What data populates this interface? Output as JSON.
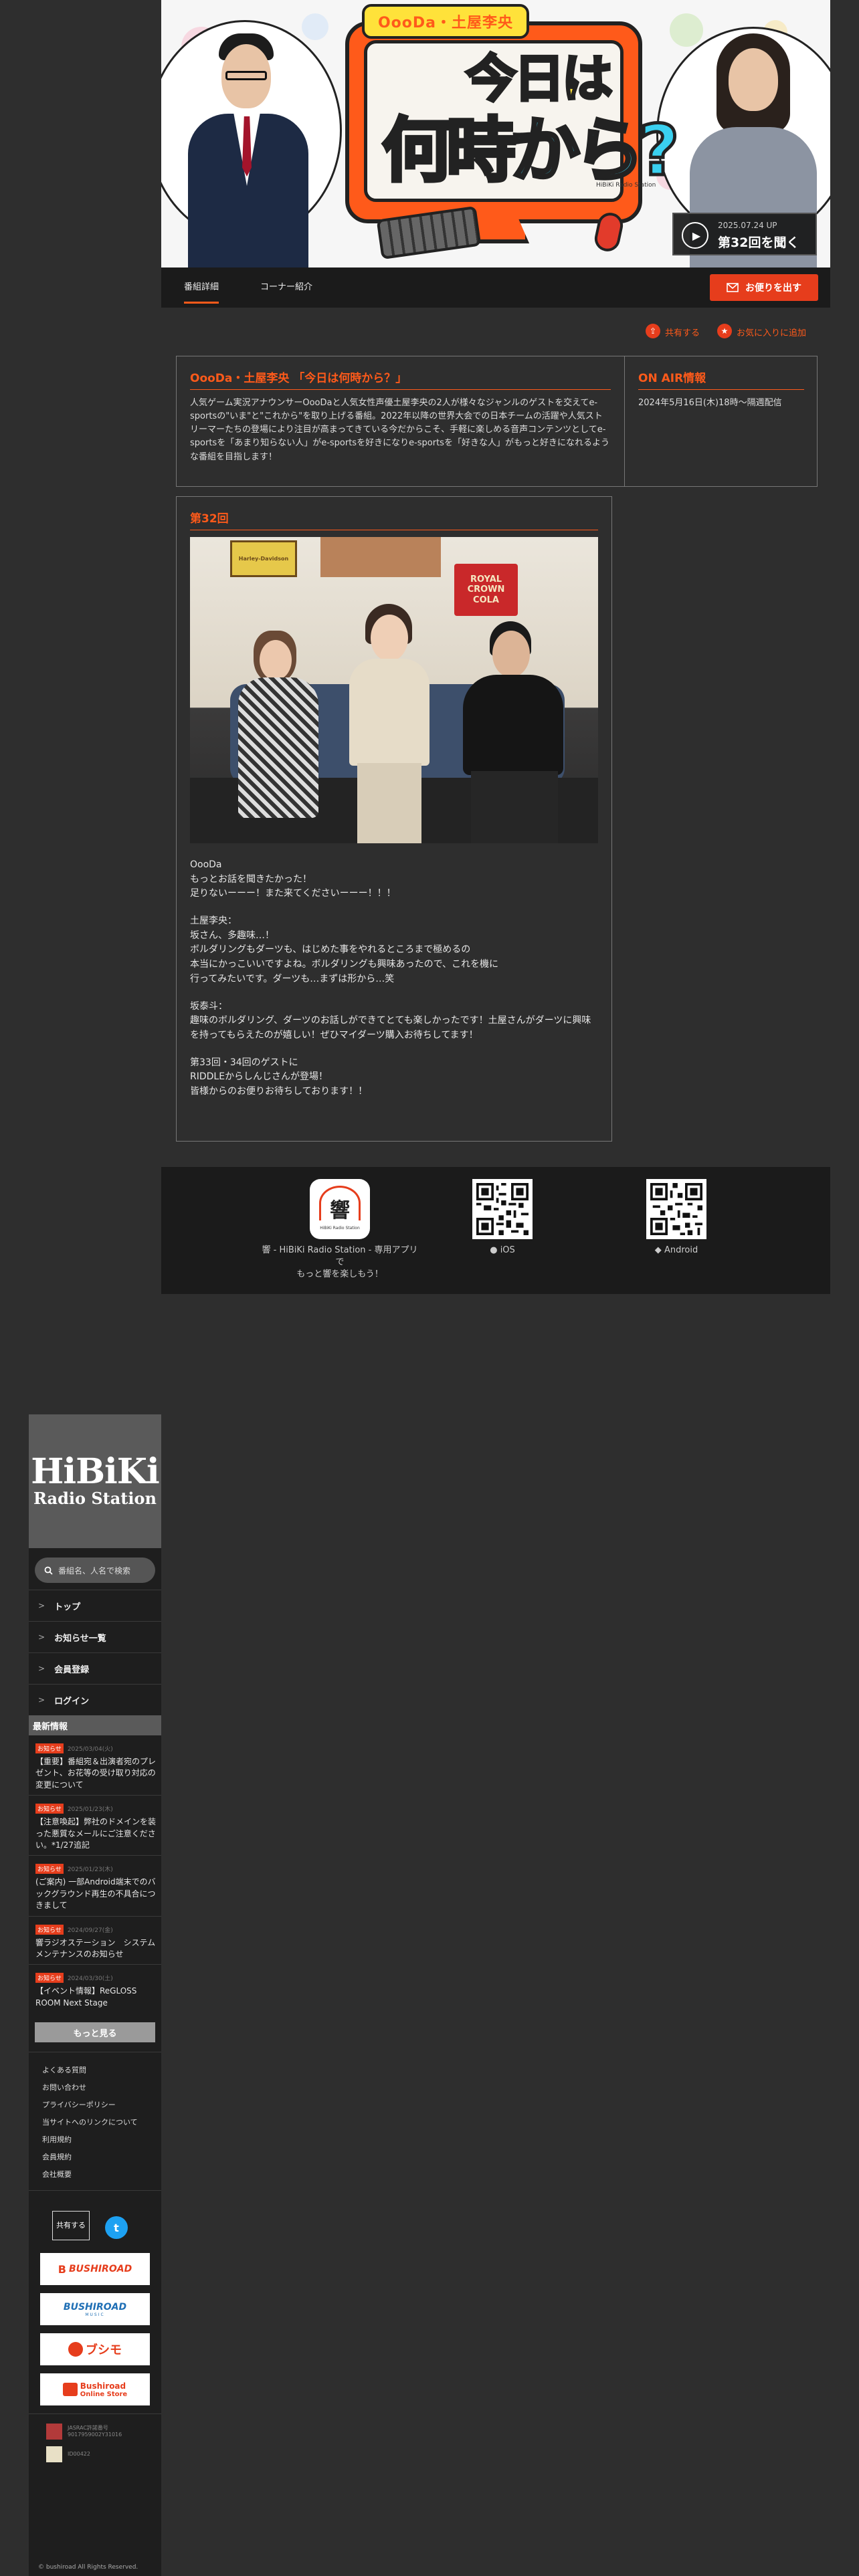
{
  "hero": {
    "logo_top": "OooDa・土屋李央",
    "title_line1": "今日は",
    "title_line2": "何時から?",
    "watermark": "HiBiKi Radio Station",
    "latest_date": "2025.07.24 UP",
    "latest_label": "第32回を聞く"
  },
  "nav": {
    "tabs": [
      "番組詳細",
      "コーナー紹介"
    ],
    "letter_button": "お便りを出す"
  },
  "actions": {
    "share": "共有する",
    "favorite": "お気に入りに追加"
  },
  "program": {
    "title": "OooDa・土屋李央 「今日は何時から？」",
    "description": "人気ゲーム実況アナウンサーOooDaと人気女性声優土屋李央の2人が様々なジャンルのゲストを交えてe-sportsの\"いま\"と\"これから\"を取り上げる番組。2022年以降の世界大会での日本チームの活躍や人気ストリーマーたちの登場により注目が高まってきている今だからこそ、手軽に楽しめる音声コンテンツとしてe-sportsを「あまり知らない人」がe-sportsを好きになりe-sportsを「好きな人」がもっと好きになれるような番組を目指します！",
    "onair_title": "ON AIR情報",
    "onair_text": "2024年5月16日(木)18時〜隔週配信"
  },
  "episode": {
    "title": "第32回",
    "photo_signs": [
      "Harley-Davidson",
      "ROYAL CROWN COLA"
    ],
    "paragraphs": [
      [
        "OooDa",
        "もっとお話を聞きたかった！",
        "足りないーーー！また来てくださいーーー！！！"
      ],
      [
        "土屋李央：",
        "坂さん、多趣味…！",
        "ボルダリングもダーツも、はじめた事をやれるところまで極めるの",
        "本当にかっこいいですよね。ボルダリングも興味あったので、これを機に",
        "行ってみたいです。ダーツも…まずは形から…笑"
      ],
      [
        "坂泰斗：",
        "趣味のボルダリング、ダーツのお話しができてとても楽しかったです！土屋さんがダーツに興味を持ってもらえたのが嬉しい！ぜひマイダーツ購入お待ちしてます！"
      ],
      [
        "第33回・34回のゲストに",
        "RIDDLEからしんじさんが登場！",
        "皆様からのお便りお待ちしております！！"
      ]
    ]
  },
  "apps": {
    "main_label_1": "響 - HiBiKi Radio Station - 専用アプリで",
    "main_label_2": "もっと響を楽しもう！",
    "app_icon_text": "響",
    "app_icon_sub": "HiBiKi Radio Station",
    "ios": "iOS",
    "android": "Android"
  },
  "sidebar": {
    "logo_1": "HiBiKi",
    "logo_2": "Radio Station",
    "search_placeholder": "番組名、人名で検索",
    "menu": [
      "トップ",
      "お知らせ一覧",
      "会員登録",
      "ログイン"
    ],
    "news_heading": "最新情報",
    "news": [
      {
        "badge": "お知らせ",
        "date": "2025/03/04(火)",
        "title": "【重要】番組宛＆出演者宛のプレゼント、お花等の受け取り対応の変更について"
      },
      {
        "badge": "お知らせ",
        "date": "2025/01/23(木)",
        "title": "【注意喚起】弊社のドメインを装った悪質なメールにご注意ください。*1/27追記"
      },
      {
        "badge": "お知らせ",
        "date": "2025/01/23(木)",
        "title": "(ご案内) 一部Android端末でのバックグラウンド再生の不具合につきまして"
      },
      {
        "badge": "お知らせ",
        "date": "2024/09/27(金)",
        "title": "響ラジオステーション　システムメンテナンスのお知らせ"
      },
      {
        "badge": "お知らせ",
        "date": "2024/03/30(土)",
        "title": "【イベント情報】ReGLOSS ROOM Next Stage"
      }
    ],
    "more": "もっと見る",
    "links": [
      "よくある質問",
      "お問い合わせ",
      "プライバシーポリシー",
      "当サイトへのリンクについて",
      "利用規約",
      "会員規約",
      "会社概要"
    ],
    "share_label": "共有する",
    "twitter_glyph": "t",
    "banners": [
      {
        "main": "BUSHIROAD",
        "sub": ""
      },
      {
        "main": "BUSHIROAD",
        "sub": "MUSIC"
      },
      {
        "main": "ブシモ",
        "sub": ""
      },
      {
        "main": "Bushiroad",
        "sub": "Online Store"
      }
    ],
    "license_1_line1": "JASRAC許諾番号",
    "license_1_line2": "9017959002Y31016",
    "license_2": "ID00422",
    "copyright": "© bushiroad All Rights Reserved."
  },
  "colors": {
    "accent": "#e63d1c",
    "hero_orange": "#ff5a1a",
    "hero_cyan": "#3ad0ef",
    "hero_yellow": "#ffe23a"
  }
}
